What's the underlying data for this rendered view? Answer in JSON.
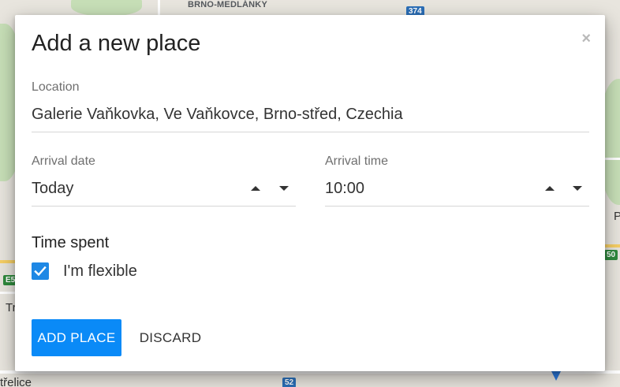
{
  "map": {
    "district_label": "BRNO-MEDLÁNKY",
    "road_374": "374",
    "road_52": "52",
    "road_50": "50",
    "road_e5": "E5",
    "place_t": "Tr",
    "place_strelice": "třelice",
    "place_p": "P"
  },
  "dialog": {
    "title": "Add a new place",
    "close_glyph": "×",
    "location": {
      "label": "Location",
      "value": "Galerie Vaňkovka, Ve Vaňkovce, Brno-střed, Czechia"
    },
    "arrival_date": {
      "label": "Arrival date",
      "value": "Today"
    },
    "arrival_time": {
      "label": "Arrival time",
      "value": "10:00"
    },
    "time_spent": {
      "heading": "Time spent",
      "flexible_label": "I'm flexible",
      "flexible_checked": true
    },
    "actions": {
      "primary_label": "ADD PLACE",
      "secondary_label": "DISCARD"
    },
    "accent_color": "#0a8af7"
  }
}
